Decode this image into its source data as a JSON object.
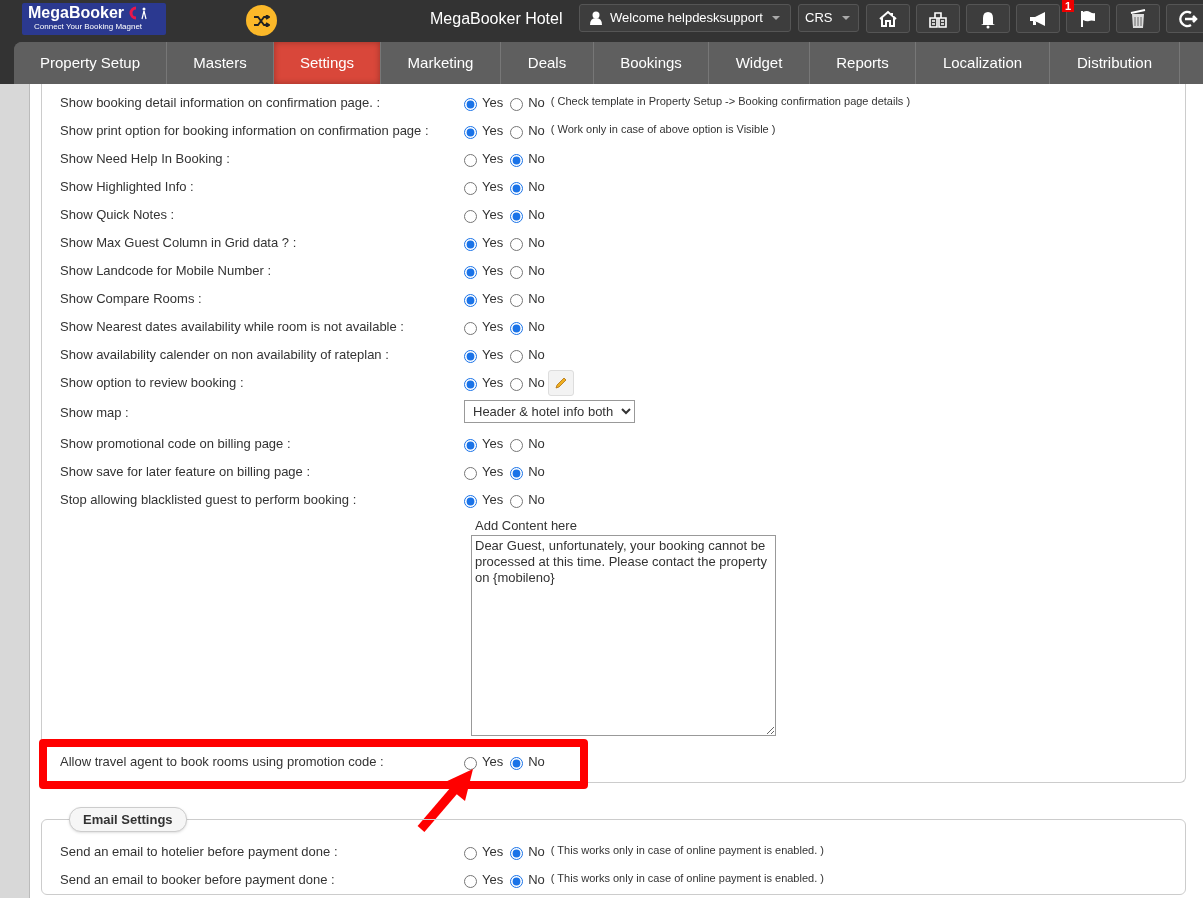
{
  "header": {
    "logo": {
      "name": "MegaBooker",
      "tagline": "Connect Your Booking Magnet"
    },
    "hotel": "MegaBooker Hotel",
    "user_menu": "Welcome helpdesksupport",
    "mode_menu": "CRS",
    "toolbar": [
      {
        "kind": "home"
      },
      {
        "kind": "buildings"
      },
      {
        "kind": "bell"
      },
      {
        "kind": "megaphone"
      },
      {
        "kind": "flag",
        "badge": "1"
      },
      {
        "kind": "trash"
      },
      {
        "kind": "logout"
      }
    ]
  },
  "tabs": [
    {
      "label": "Property Setup",
      "selected": false
    },
    {
      "label": "Masters",
      "selected": false
    },
    {
      "label": "Settings",
      "selected": true
    },
    {
      "label": "Marketing",
      "selected": false
    },
    {
      "label": "Deals",
      "selected": false
    },
    {
      "label": "Bookings",
      "selected": false
    },
    {
      "label": "Widget",
      "selected": false
    },
    {
      "label": "Reports",
      "selected": false
    },
    {
      "label": "Localization",
      "selected": false
    },
    {
      "label": "Distribution",
      "selected": false
    }
  ],
  "settings": [
    {
      "kind": "radio",
      "label": "Show booking detail information on confirmation page. :",
      "options": [
        {
          "label": "Yes",
          "selected": true
        },
        {
          "label": "No",
          "selected": false
        }
      ],
      "note": "( Check template in Property Setup -> Booking confirmation page details )"
    },
    {
      "kind": "radio",
      "label": "Show print option for booking information on confirmation page :",
      "options": [
        {
          "label": "Yes",
          "selected": true
        },
        {
          "label": "No",
          "selected": false
        }
      ],
      "note": "( Work only in case of above option is Visible )"
    },
    {
      "kind": "radio",
      "label": "Show Need Help In Booking :",
      "options": [
        {
          "label": "Yes",
          "selected": false
        },
        {
          "label": "No",
          "selected": true
        }
      ]
    },
    {
      "kind": "radio",
      "label": "Show Highlighted Info :",
      "options": [
        {
          "label": "Yes",
          "selected": false
        },
        {
          "label": "No",
          "selected": true
        }
      ]
    },
    {
      "kind": "radio",
      "label": "Show Quick Notes :",
      "options": [
        {
          "label": "Yes",
          "selected": false
        },
        {
          "label": "No",
          "selected": true
        }
      ]
    },
    {
      "kind": "radio",
      "label": "Show Max Guest Column in Grid data ? :",
      "options": [
        {
          "label": "Yes",
          "selected": true
        },
        {
          "label": "No",
          "selected": false
        }
      ]
    },
    {
      "kind": "radio",
      "label": "Show Landcode for Mobile Number :",
      "options": [
        {
          "label": "Yes",
          "selected": true
        },
        {
          "label": "No",
          "selected": false
        }
      ]
    },
    {
      "kind": "radio",
      "label": "Show Compare Rooms :",
      "options": [
        {
          "label": "Yes",
          "selected": true
        },
        {
          "label": "No",
          "selected": false
        }
      ]
    },
    {
      "kind": "radio",
      "label": "Show Nearest dates availability while room is not available :",
      "options": [
        {
          "label": "Yes",
          "selected": false
        },
        {
          "label": "No",
          "selected": true
        }
      ]
    },
    {
      "kind": "radio",
      "label": "Show availability calender on non availability of rateplan :",
      "options": [
        {
          "label": "Yes",
          "selected": true
        },
        {
          "label": "No",
          "selected": false
        }
      ]
    },
    {
      "kind": "radio",
      "label": "Show option to review booking :",
      "options": [
        {
          "label": "Yes",
          "selected": true
        },
        {
          "label": "No",
          "selected": false
        }
      ],
      "edit_button": true
    },
    {
      "kind": "select",
      "label": "Show map :",
      "value": "Header & hotel info both"
    },
    {
      "kind": "radio",
      "label": "Show promotional code on billing page :",
      "options": [
        {
          "label": "Yes",
          "selected": true
        },
        {
          "label": "No",
          "selected": false
        }
      ]
    },
    {
      "kind": "radio",
      "label": "Show save for later feature on billing page :",
      "options": [
        {
          "label": "Yes",
          "selected": false
        },
        {
          "label": "No",
          "selected": true
        }
      ]
    },
    {
      "kind": "radio",
      "label": "Stop allowing blacklisted guest to perform booking :",
      "options": [
        {
          "label": "Yes",
          "selected": true
        },
        {
          "label": "No",
          "selected": false
        }
      ]
    },
    {
      "kind": "textarea",
      "caption": "Add Content here",
      "value": "Dear Guest, unfortunately, your booking cannot be processed at this time. Please contact the property on {mobileno}"
    },
    {
      "kind": "radio",
      "label": "Allow travel agent to book rooms using promotion code :",
      "options": [
        {
          "label": "Yes",
          "selected": false
        },
        {
          "label": "No",
          "selected": true
        }
      ],
      "highlighted": true
    }
  ],
  "email_settings": {
    "legend": "Email Settings",
    "rows": [
      {
        "kind": "radio",
        "label": "Send an email to hotelier before payment done :",
        "options": [
          {
            "label": "Yes",
            "selected": false
          },
          {
            "label": "No",
            "selected": true
          }
        ],
        "note": "( This works only in case of online payment is enabled. )"
      },
      {
        "kind": "radio",
        "label": "Send an email to booker before payment done :",
        "options": [
          {
            "label": "Yes",
            "selected": false
          },
          {
            "label": "No",
            "selected": true
          }
        ],
        "note": "( This works only in case of online payment is enabled. )"
      }
    ]
  }
}
